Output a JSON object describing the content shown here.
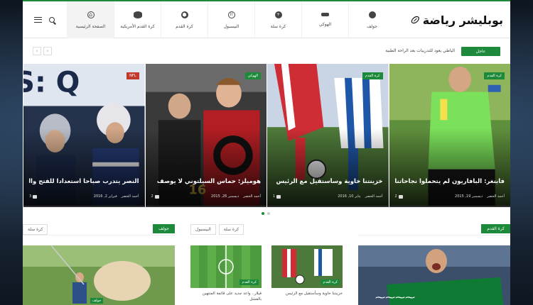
{
  "site": {
    "logo_text": "بوبليشر رياضة"
  },
  "nav": {
    "items": [
      {
        "label": "الصفحة الرئيسية",
        "icon": "home-icon",
        "active": true
      },
      {
        "label": "كرة القدم الأمريكية",
        "icon": "american-football-icon"
      },
      {
        "label": "كرة القدم",
        "icon": "soccer-ball-icon"
      },
      {
        "label": "البيسبول",
        "icon": "baseball-icon"
      },
      {
        "label": "كرة سلة",
        "icon": "basketball-icon"
      },
      {
        "label": "الهوكي",
        "icon": "hockey-icon"
      },
      {
        "label": "جولف",
        "icon": "golf-icon"
      }
    ]
  },
  "breaking": {
    "label": "عاجل",
    "text": "الياطي يعود للتدريبات بعد الراحة الطبية"
  },
  "slides": [
    {
      "category": "NFL",
      "title": "النصر يتدرب صباحا استعدادا للفتح والزمالك",
      "author": "أحمد الخضر",
      "date": "فبراير 2, 2016",
      "comments": "3"
    },
    {
      "category": "الهوكي",
      "title": "هوميلز: حماس السيلتوني لا يوصف",
      "author": "أحمد الخضر",
      "date": "ديسمبر 26, 2015",
      "comments": "2"
    },
    {
      "category": "كرة القدم",
      "title": "خزينتنا خاوية وسأستقيل مع الرئيس",
      "author": "أحمد الخضر",
      "date": "يناير 10, 2016",
      "comments": "1"
    },
    {
      "category": "كرة القدم",
      "title": "فابنغر: البافاريون لم يتحملوا نجاحاتنا",
      "author": "أحمد الخضر",
      "date": "ديسمبر 19, 2015",
      "comments": "2"
    }
  ],
  "blocks": {
    "football": {
      "title": "كرة القدم",
      "thumbs": [
        {
          "category": "كرة القدم",
          "caption": "خزينتنا خاوية وسأستقيل مع الرئيس"
        },
        {
          "category": "كرة القدم",
          "caption": "فيلار.. واعد جديد على قائمة المنتهين بالفشل"
        }
      ]
    },
    "golf": {
      "title": "جولف",
      "tabs": [
        "كرة سلة"
      ],
      "thumb_category": "جولف"
    },
    "mid_tabs": [
      "كرة سلة",
      "البيسبول"
    ]
  },
  "colors": {
    "accent": "#1c8a3a"
  }
}
